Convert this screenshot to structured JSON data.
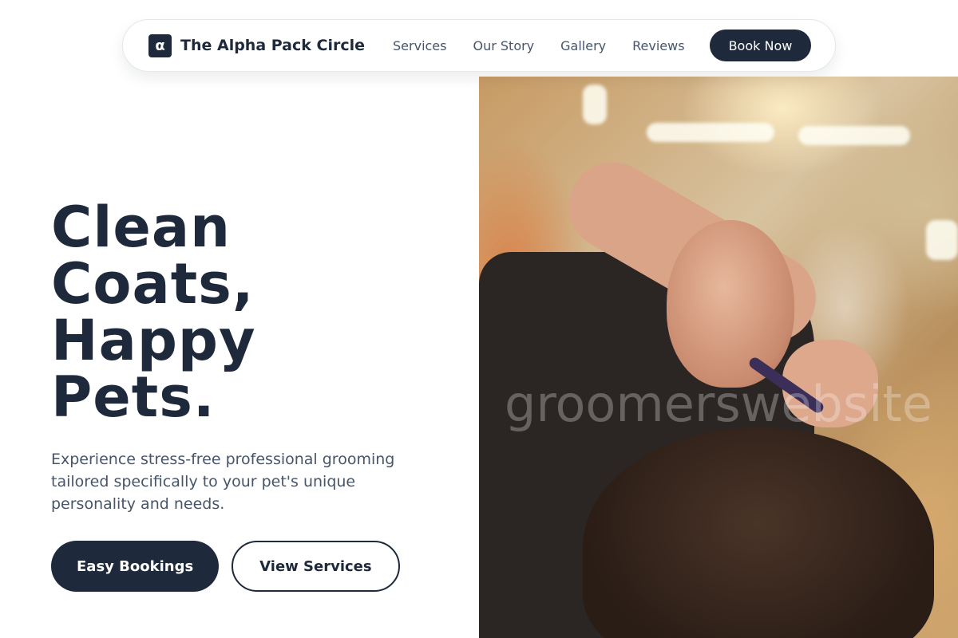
{
  "brand": {
    "logo_glyph": "α",
    "name": "The Alpha Pack Circle"
  },
  "nav": {
    "links": [
      {
        "label": "Services"
      },
      {
        "label": "Our Story"
      },
      {
        "label": "Gallery"
      },
      {
        "label": "Reviews"
      }
    ],
    "cta_label": "Book Now"
  },
  "hero": {
    "title_lines": [
      "Clean",
      "Coats,",
      "Happy",
      "Pets."
    ],
    "subtitle": "Experience stress-free professional grooming tailored specifically to your pet's unique personality and needs.",
    "primary_button": "Easy Bookings",
    "secondary_button": "View Services",
    "image_watermark": "groomerswebsite"
  },
  "colors": {
    "primary": "#1e293b",
    "muted_text": "#475569",
    "background": "#ffffff"
  }
}
